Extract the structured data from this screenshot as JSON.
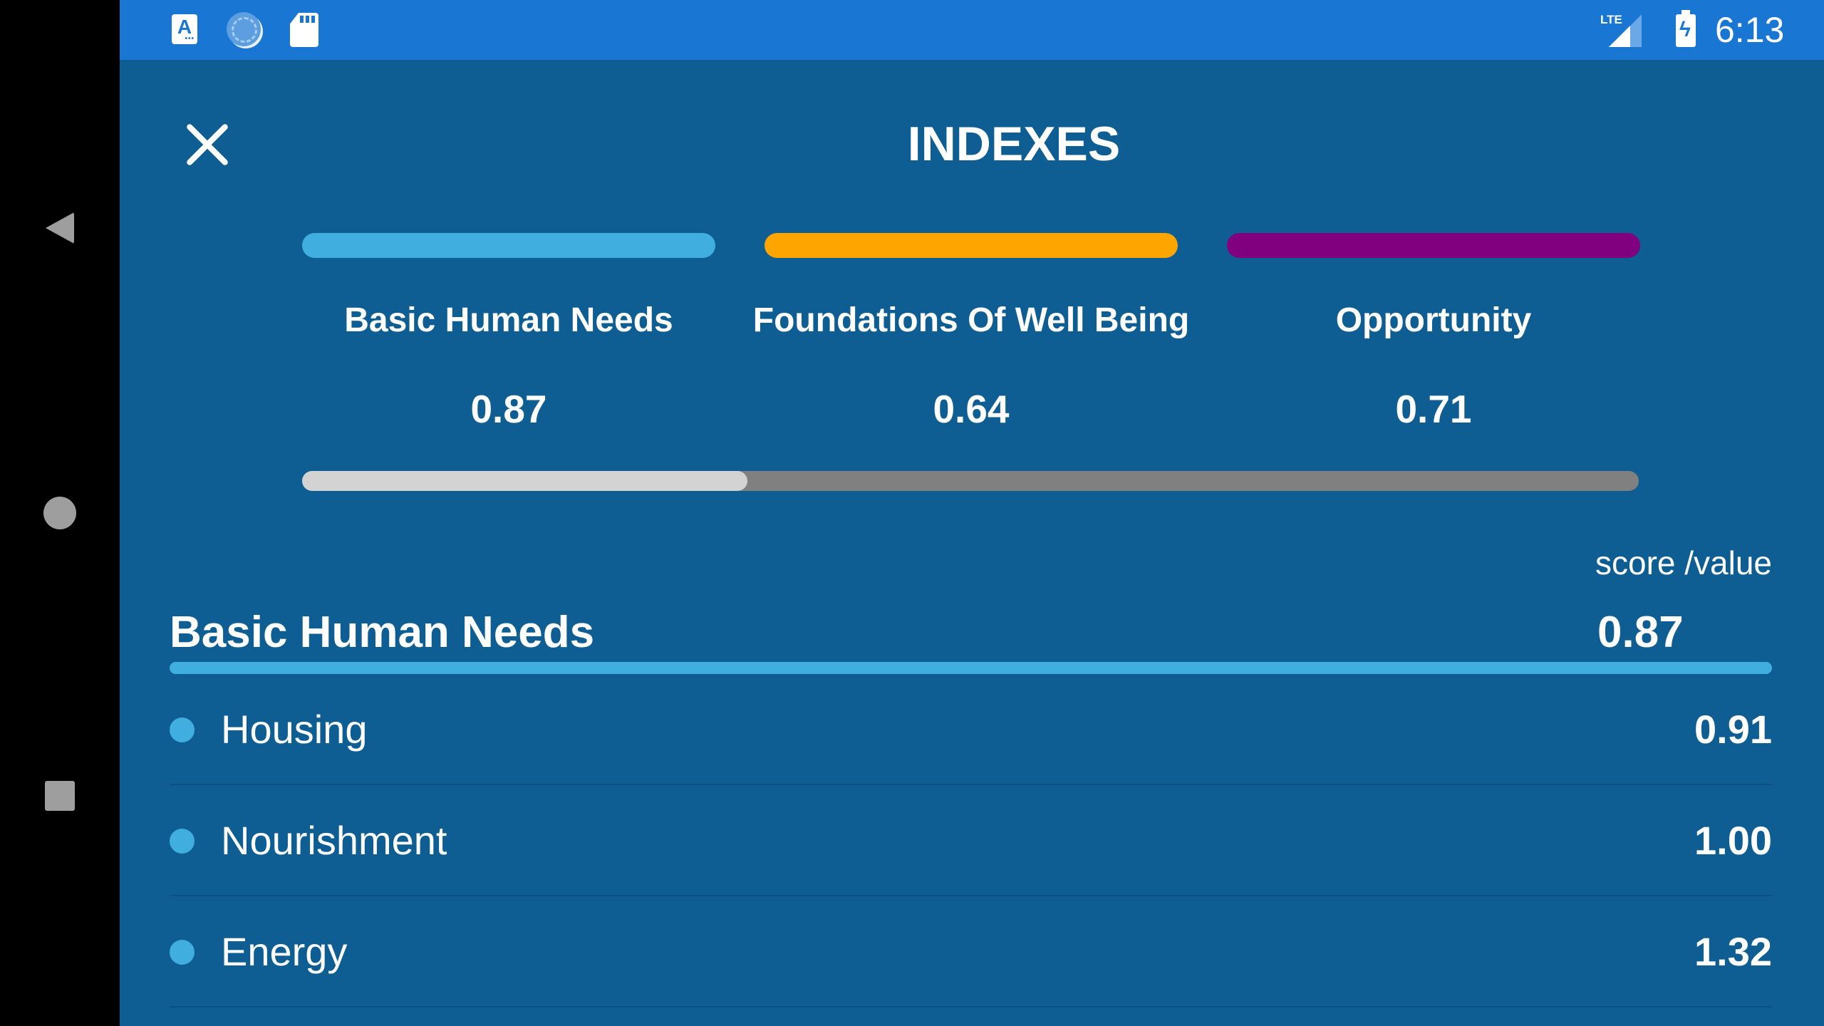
{
  "status_bar": {
    "left_icons": [
      "keyboard-a-icon",
      "sync-icon",
      "sd-card-icon"
    ],
    "network": "LTE",
    "time": "6:13",
    "battery": "charging"
  },
  "nav_bar": {
    "buttons": [
      "back",
      "home",
      "recents"
    ]
  },
  "header": {
    "title": "INDEXES",
    "close_icon": "close-icon"
  },
  "indexes": [
    {
      "label": "Basic Human Needs",
      "value": "0.87",
      "color": "#41aee0"
    },
    {
      "label": "Foundations Of Well Being",
      "value": "0.64",
      "color": "#ffa500"
    },
    {
      "label": "Opportunity",
      "value": "0.71",
      "color": "#800080"
    }
  ],
  "pager": {
    "page": 1,
    "total_pages": 3,
    "thumb_color": "#d3d3d3",
    "track_color": "#808080"
  },
  "section": {
    "column_header": "score /value",
    "title": "Basic Human Needs",
    "value": "0.87",
    "accent": "#41aee0",
    "rows": [
      {
        "label": "Housing",
        "value": "0.91"
      },
      {
        "label": "Nourishment",
        "value": "1.00"
      },
      {
        "label": "Energy",
        "value": "1.32"
      }
    ]
  },
  "colors": {
    "background": "#0e5e93",
    "status_bar": "#1976d2"
  }
}
